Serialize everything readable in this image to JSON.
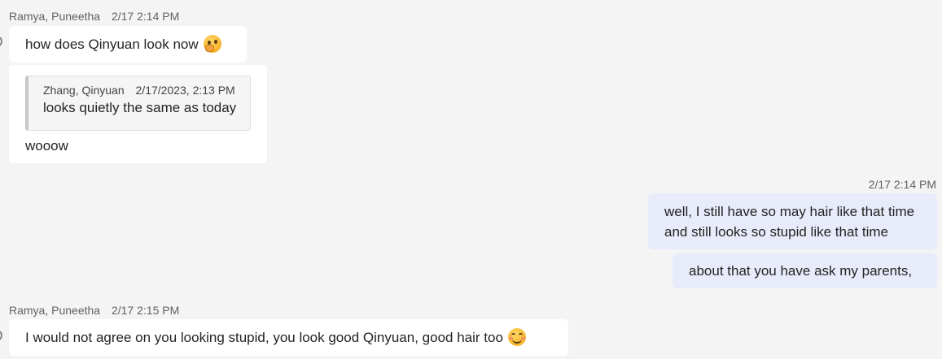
{
  "messages": [
    {
      "sender": "Ramya, Puneetha",
      "time": "2/17 2:14 PM",
      "bubbles": [
        {
          "text": "how does Qinyuan look now",
          "emoji": "thinking-face-emoji"
        },
        {
          "quote": {
            "sender": "Zhang, Qinyuan",
            "time": "2/17/2023, 2:13 PM",
            "text": "looks quietly the same as today"
          },
          "text": "wooow"
        }
      ]
    },
    {
      "sender": "me",
      "time": "2/17 2:14 PM",
      "bubbles": [
        {
          "lines": [
            "well, I still have so may hair like that time",
            "and still looks so stupid like that time"
          ]
        },
        {
          "text": "about that you have ask my parents,"
        }
      ]
    },
    {
      "sender": "Ramya, Puneetha",
      "time": "2/17 2:15 PM",
      "bubbles": [
        {
          "text": "I would not agree on you looking stupid, you look good Qinyuan, good hair too",
          "emoji": "smiling-face-emoji"
        }
      ]
    }
  ],
  "colors": {
    "background": "#f4f4f4",
    "incoming_bubble": "#ffffff",
    "outgoing_bubble": "#e8ebfa",
    "meta_text": "#616161"
  }
}
